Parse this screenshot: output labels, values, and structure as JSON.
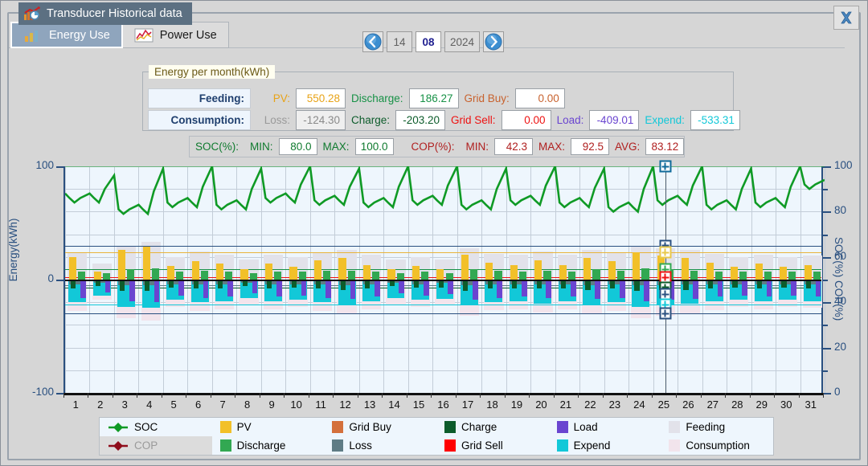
{
  "window": {
    "title": "Transducer Historical data",
    "close_label": "✖"
  },
  "tabs": [
    {
      "label": "Energy Use",
      "selected": true,
      "icon": "bar-chart-icon"
    },
    {
      "label": "Power Use",
      "selected": false,
      "icon": "line-chart-icon"
    }
  ],
  "datenav": {
    "prev_icon": "chevron-left-icon",
    "next_icon": "chevron-right-icon",
    "day": "14",
    "month": "08",
    "year": "2024",
    "active_field": "month"
  },
  "energy_group": {
    "title": "Energy per month(kWh)",
    "row1": {
      "header": "Feeding:",
      "items": [
        {
          "label": "PV:",
          "value": "550.28",
          "color": "#e8a317"
        },
        {
          "label": "Discharge:",
          "value": "186.27",
          "color": "#179146"
        },
        {
          "label": "Grid Buy:",
          "value": "0.00",
          "color": "#c8622e"
        }
      ]
    },
    "row2": {
      "header": "Consumption:",
      "items": [
        {
          "label": "Loss:",
          "value": "-124.30",
          "color": "#9a9a9a"
        },
        {
          "label": "Charge:",
          "value": "-203.20",
          "color": "#0d5c2b"
        },
        {
          "label": "Grid Sell:",
          "value": "0.00",
          "color": "#ee1111"
        },
        {
          "label": "Load:",
          "value": "-409.01",
          "color": "#6a45d0"
        },
        {
          "label": "Expend:",
          "value": "-533.31",
          "color": "#12c8d8"
        }
      ]
    }
  },
  "statbar": {
    "soc": {
      "title": "SOC(%):",
      "min_label": "MIN:",
      "min_value": "80.0",
      "max_label": "MAX:",
      "max_value": "100.0"
    },
    "cop": {
      "title": "COP(%):",
      "min_label": "MIN:",
      "min_value": "42.3",
      "max_label": "MAX:",
      "max_value": "92.5",
      "avg_label": "AVG:",
      "avg_value": "83.12"
    }
  },
  "legend": [
    {
      "name": "SOC",
      "color": "#0f9a25",
      "marker": "diamond",
      "enabled": true
    },
    {
      "name": "COP",
      "color": "#8f0d1b",
      "marker": "diamond",
      "enabled": false
    },
    {
      "name": "PV",
      "color": "#f2c029",
      "marker": "square",
      "enabled": true
    },
    {
      "name": "Discharge",
      "color": "#32a852",
      "marker": "square",
      "enabled": true
    },
    {
      "name": "Grid Buy",
      "color": "#d4703c",
      "marker": "square",
      "enabled": true
    },
    {
      "name": "Loss",
      "color": "#5f7c85",
      "marker": "square",
      "enabled": true
    },
    {
      "name": "Charge",
      "color": "#0d5c2b",
      "marker": "square",
      "enabled": true
    },
    {
      "name": "Grid Sell",
      "color": "#ff0000",
      "marker": "square",
      "enabled": true
    },
    {
      "name": "Load",
      "color": "#6a45d0",
      "marker": "square",
      "enabled": true
    },
    {
      "name": "Expend",
      "color": "#12c8d8",
      "marker": "square",
      "enabled": true
    },
    {
      "name": "Feeding",
      "color": "#e2e2ea",
      "marker": "square",
      "enabled": true
    },
    {
      "name": "Consumption",
      "color": "#f2e4ec",
      "marker": "square",
      "enabled": true
    }
  ],
  "chart_data": {
    "type": "bar",
    "title": "Energy per month(kWh)",
    "xlabel": "",
    "ylabel": "Energy(kWh)",
    "y2label": "SOC(%) COP(%)",
    "ylim": [
      -100,
      100
    ],
    "y2lim": [
      0,
      100
    ],
    "yticks": [
      100,
      0,
      -100
    ],
    "y2ticks": [
      0,
      20,
      40,
      60,
      80,
      100
    ],
    "grid": true,
    "legend_position": "bottom",
    "categories": [
      1,
      2,
      3,
      4,
      5,
      6,
      7,
      8,
      9,
      10,
      11,
      12,
      13,
      14,
      15,
      16,
      17,
      18,
      19,
      20,
      21,
      22,
      23,
      24,
      25,
      26,
      27,
      28,
      29,
      30,
      31
    ],
    "selected_category": 25,
    "series": [
      {
        "name": "Feeding",
        "type": "band",
        "color": "#e2e2ea",
        "values": [
          24,
          14,
          30,
          33,
          20,
          25,
          22,
          18,
          22,
          20,
          24,
          26,
          22,
          18,
          20,
          18,
          28,
          23,
          22,
          25,
          22,
          26,
          24,
          30,
          28,
          26,
          23,
          20,
          22,
          20,
          21
        ]
      },
      {
        "name": "Consumption",
        "type": "band",
        "color": "#f2e4ec",
        "values": [
          -28,
          -18,
          -34,
          -36,
          -24,
          -28,
          -26,
          -22,
          -26,
          -24,
          -28,
          -30,
          -26,
          -22,
          -24,
          -22,
          -32,
          -27,
          -26,
          -29,
          -26,
          -30,
          -28,
          -34,
          -32,
          -30,
          -27,
          -24,
          -26,
          -24,
          -25
        ]
      },
      {
        "name": "PV",
        "type": "positive",
        "color": "#f2c029",
        "values": [
          20,
          7,
          26,
          29,
          12,
          16,
          14,
          9,
          14,
          11,
          17,
          19,
          13,
          9,
          12,
          9,
          22,
          15,
          13,
          17,
          13,
          19,
          16,
          24,
          21,
          19,
          15,
          11,
          14,
          11,
          13
        ]
      },
      {
        "name": "Discharge",
        "type": "positive",
        "color": "#32a852",
        "values": [
          7,
          6,
          9,
          10,
          7,
          8,
          7,
          6,
          7,
          7,
          8,
          8,
          7,
          6,
          7,
          6,
          9,
          8,
          7,
          8,
          7,
          9,
          8,
          10,
          9,
          8,
          7,
          7,
          7,
          7,
          7
        ]
      },
      {
        "name": "Grid Buy",
        "type": "positive",
        "color": "#d4703c",
        "values": [
          0,
          0,
          0,
          0,
          0,
          0,
          0,
          0,
          0,
          0,
          0,
          0,
          0,
          0,
          0,
          0,
          0,
          0,
          0,
          0,
          0,
          0,
          0,
          0,
          0,
          0,
          0,
          0,
          0,
          0,
          0
        ]
      },
      {
        "name": "Loss",
        "type": "negative",
        "color": "#5f7c85",
        "values": [
          -4,
          -3,
          -5,
          -5,
          -4,
          -4,
          -4,
          -3,
          -4,
          -4,
          -4,
          -5,
          -4,
          -3,
          -4,
          -3,
          -5,
          -4,
          -4,
          -4,
          -4,
          -5,
          -4,
          -5,
          -5,
          -4,
          -4,
          -4,
          -4,
          -4,
          -4
        ]
      },
      {
        "name": "Charge",
        "type": "negative",
        "color": "#0d5c2b",
        "values": [
          -8,
          -6,
          -10,
          -10,
          -7,
          -8,
          -8,
          -6,
          -8,
          -7,
          -8,
          -9,
          -8,
          -6,
          -7,
          -7,
          -10,
          -8,
          -8,
          -8,
          -8,
          -9,
          -8,
          -10,
          -9,
          -9,
          -8,
          -7,
          -8,
          -7,
          -8
        ]
      },
      {
        "name": "Grid Sell",
        "type": "negative",
        "color": "#ff0000",
        "values": [
          0,
          0,
          0,
          0,
          0,
          0,
          0,
          0,
          0,
          0,
          0,
          0,
          0,
          0,
          0,
          0,
          0,
          0,
          0,
          0,
          0,
          0,
          0,
          0,
          0,
          0,
          0,
          0,
          0,
          0,
          0
        ]
      },
      {
        "name": "Load",
        "type": "negative",
        "color": "#6a45d0",
        "values": [
          -16,
          -11,
          -19,
          -20,
          -14,
          -16,
          -15,
          -12,
          -15,
          -14,
          -16,
          -17,
          -15,
          -12,
          -14,
          -13,
          -18,
          -16,
          -15,
          -16,
          -15,
          -17,
          -16,
          -19,
          -18,
          -17,
          -15,
          -14,
          -15,
          -14,
          -15
        ]
      },
      {
        "name": "Expend",
        "type": "negative",
        "color": "#12c8d8",
        "values": [
          -20,
          -14,
          -24,
          -25,
          -18,
          -20,
          -19,
          -16,
          -19,
          -18,
          -20,
          -22,
          -19,
          -16,
          -18,
          -17,
          -23,
          -20,
          -19,
          -21,
          -19,
          -22,
          -20,
          -24,
          -23,
          -21,
          -19,
          -18,
          -19,
          -18,
          -19
        ]
      },
      {
        "name": "SOC",
        "type": "line",
        "color": "#0f9a25",
        "axis": "right",
        "values": [
          88,
          96,
          83,
          99,
          86,
          100,
          85,
          99,
          88,
          100,
          87,
          99,
          86,
          100,
          87,
          100,
          85,
          99,
          87,
          100,
          86,
          99,
          84,
          100,
          87,
          100,
          85,
          99,
          86,
          100,
          94
        ]
      }
    ],
    "reference_lines": [
      {
        "name": "feeding-top",
        "color": "#2a5080",
        "value": 30
      },
      {
        "name": "pv-level",
        "color": "#e8b33a",
        "value": 24
      },
      {
        "name": "discharge-level",
        "color": "#179146",
        "value": 9
      },
      {
        "name": "zero",
        "color": "#111111",
        "value": 0
      },
      {
        "name": "gridsell-level",
        "color": "#ee1111",
        "value": 2
      },
      {
        "name": "loss-level",
        "color": "#5f7c85",
        "value": -5
      },
      {
        "name": "charge-level",
        "color": "#0d5c2b",
        "value": -7
      },
      {
        "name": "expend-level",
        "color": "#12c8d8",
        "value": -22
      },
      {
        "name": "consumption-bot",
        "color": "#2a5080",
        "value": -30
      }
    ]
  }
}
